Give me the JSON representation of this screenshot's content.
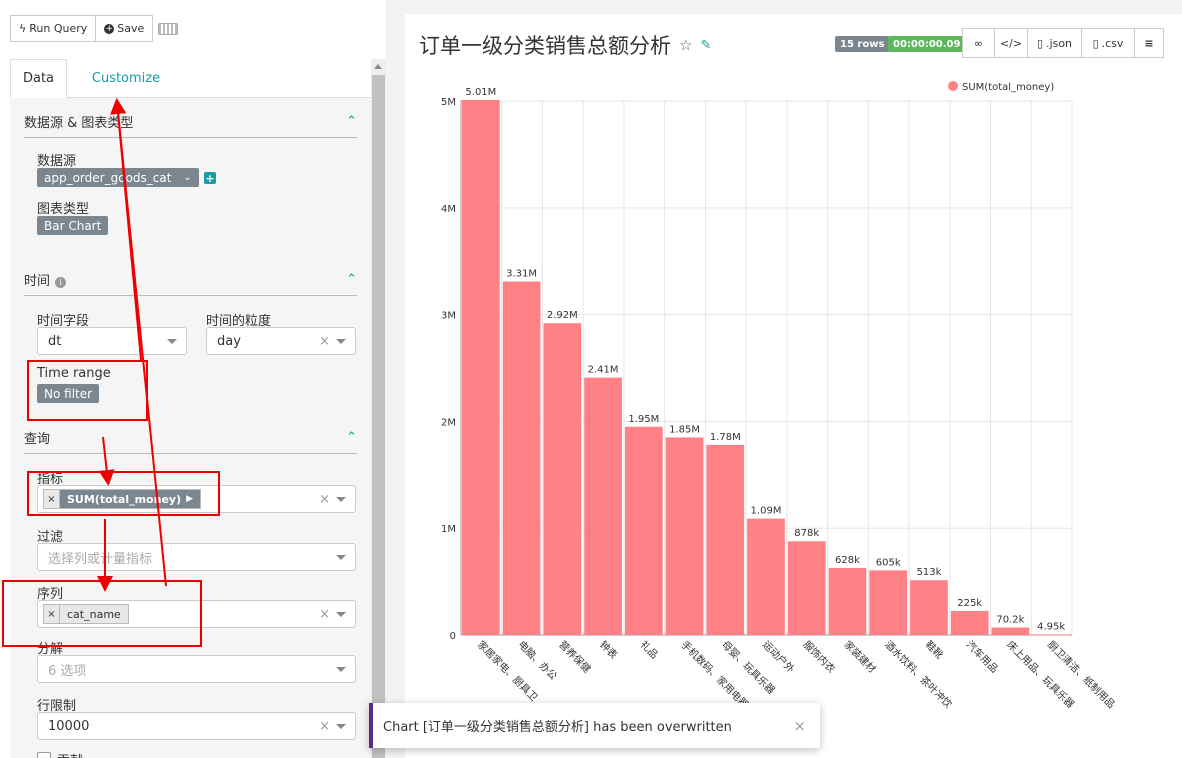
{
  "toolbar": {
    "run_query": "Run Query",
    "save": "Save"
  },
  "tabs": {
    "data": "Data",
    "customize": "Customize"
  },
  "datasource_section": {
    "title": "数据源 & 图表类型",
    "datasource_label": "数据源",
    "datasource_value": "app_order_goods_cat",
    "chart_type_label": "图表类型",
    "chart_type_value": "Bar Chart"
  },
  "time_section": {
    "title": "时间",
    "time_column_label": "时间字段",
    "time_column_value": "dt",
    "time_grain_label": "时间的粒度",
    "time_grain_value": "day",
    "time_range_label": "Time range",
    "time_range_value": "No filter"
  },
  "query_section": {
    "title": "查询",
    "metrics_label": "指标",
    "metrics_value": "SUM(total_money)",
    "filters_label": "过滤",
    "filters_placeholder": "选择列或计量指标",
    "series_label": "序列",
    "series_value": "cat_name",
    "breakdowns_label": "分解",
    "breakdowns_placeholder": "6 选项",
    "row_limit_label": "行限制",
    "row_limit_value": "10000",
    "contribution_label": "贡献"
  },
  "header": {
    "title": "订单一级分类销售总额分析",
    "rows_badge": "15 rows",
    "time_badge": "00:00:00.09",
    "json_label": ".json",
    "csv_label": ".csv"
  },
  "toast": {
    "message": "Chart [订单一级分类销售总额分析] has been overwritten"
  },
  "colors": {
    "bar": "#ff8185",
    "accent": "#1a9ba6",
    "rows_badge": "#7b868e",
    "time_badge": "#5cb85c"
  },
  "chart_data": {
    "type": "bar",
    "series": [
      {
        "name": "SUM(total_money)",
        "values": [
          5010000,
          3310000,
          2920000,
          2410000,
          1950000,
          1850000,
          1780000,
          1090000,
          878000,
          628000,
          605000,
          513000,
          225000,
          70200,
          4950
        ]
      }
    ],
    "categories": [
      "家居家电、厨具卫",
      "电脑、办公",
      "营养保健",
      "钟表",
      "礼品",
      "手机数码、家用电器",
      "母婴、玩具乐器",
      "运动户外",
      "服饰内衣",
      "家装建材",
      "酒水饮料、茶叶冲饮",
      "鞋靴",
      "汽车用品",
      "床上用品、玩具乐器",
      "厨卫清洁、纸制用品"
    ],
    "data_labels": [
      "5.01M",
      "3.31M",
      "2.92M",
      "2.41M",
      "1.95M",
      "1.85M",
      "1.78M",
      "1.09M",
      "878k",
      "628k",
      "605k",
      "513k",
      "225k",
      "70.2k",
      "4.95k"
    ],
    "yticks": [
      0,
      1000000,
      2000000,
      3000000,
      4000000,
      5000000
    ],
    "ytick_labels": [
      "0",
      "1M",
      "2M",
      "3M",
      "4M",
      "5M"
    ],
    "ylim": [
      0,
      5010000
    ],
    "grid": true,
    "legend_position": "top-right"
  }
}
